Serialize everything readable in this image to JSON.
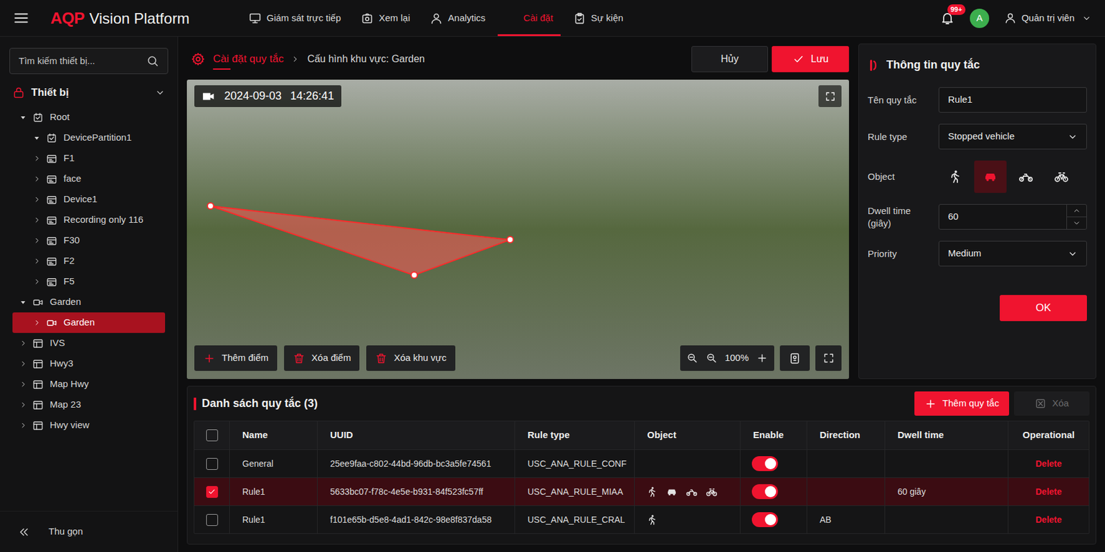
{
  "app": {
    "logo_mark": "AQP",
    "logo_text": "Vision Platform"
  },
  "nav": [
    {
      "label": "Giám sát trực tiếp",
      "kind": "monitor",
      "selected": false
    },
    {
      "label": "Xem lại",
      "kind": "playback",
      "selected": false
    },
    {
      "label": "Analytics",
      "kind": "analytics",
      "selected": false
    },
    {
      "label": "Cài đặt",
      "kind": "settings",
      "selected": true
    },
    {
      "label": "Sự kiện",
      "kind": "events",
      "selected": false
    }
  ],
  "header": {
    "notifications": "99+",
    "avatar": "A",
    "user": "Quản trị viên"
  },
  "sidebar": {
    "search": {
      "placeholder": "Tìm kiếm thiết bị..."
    },
    "section": {
      "label": "Thiết bị",
      "expanded": true
    },
    "tree": [
      {
        "label": "Root",
        "level": 0,
        "kind": "partition",
        "expanded": true,
        "selected": false
      },
      {
        "label": "DevicePartition1",
        "level": 1,
        "kind": "partition",
        "expanded": true,
        "selected": false
      },
      {
        "label": "F1",
        "level": 1,
        "kind": "device",
        "expanded": false,
        "selected": false
      },
      {
        "label": "face",
        "level": 1,
        "kind": "device",
        "expanded": false,
        "selected": false
      },
      {
        "label": "Device1",
        "level": 1,
        "kind": "device",
        "expanded": false,
        "selected": false
      },
      {
        "label": "Recording only 116",
        "level": 1,
        "kind": "device",
        "expanded": false,
        "selected": false
      },
      {
        "label": "F30",
        "level": 1,
        "kind": "device",
        "expanded": false,
        "selected": false
      },
      {
        "label": "F2",
        "level": 1,
        "kind": "device",
        "expanded": false,
        "selected": false
      },
      {
        "label": "F5",
        "level": 1,
        "kind": "device",
        "expanded": false,
        "selected": false
      },
      {
        "label": "Garden",
        "level": 0,
        "kind": "camera",
        "expanded": true,
        "selected": false
      },
      {
        "label": "Garden",
        "level": 1,
        "kind": "camera",
        "expanded": false,
        "selected": true
      },
      {
        "label": "IVS",
        "level": 0,
        "kind": "view",
        "expanded": false,
        "selected": false
      },
      {
        "label": "Hwy3",
        "level": 0,
        "kind": "view",
        "expanded": false,
        "selected": false
      },
      {
        "label": "Map Hwy",
        "level": 0,
        "kind": "view",
        "expanded": false,
        "selected": false
      },
      {
        "label": "Map 23",
        "level": 0,
        "kind": "view",
        "expanded": false,
        "selected": false
      },
      {
        "label": "Hwy view",
        "level": 0,
        "kind": "view",
        "expanded": false,
        "selected": false
      }
    ],
    "collapse": "Thu gọn"
  },
  "breadcrumb": [
    {
      "label": "Cài đặt quy tắc",
      "selected": true
    },
    {
      "label": "Cấu hình khu vực: Garden",
      "selected": false
    }
  ],
  "actions": {
    "cancel": "Hủy",
    "save": "Lưu"
  },
  "video": {
    "date": "2024-09-03",
    "time": "14:26:41",
    "region": {
      "points": [
        [
          0.036,
          0.422
        ],
        [
          0.488,
          0.535
        ],
        [
          0.343,
          0.653
        ]
      ]
    },
    "tools": [
      {
        "label": "Thêm điểm",
        "kind": "add"
      },
      {
        "label": "Xóa điểm",
        "kind": "delete"
      },
      {
        "label": "Xóa khu vực",
        "kind": "delete"
      }
    ],
    "zoom": "100%"
  },
  "rule_form": {
    "title": "Thông tin quy tắc",
    "name": {
      "label": "Tên quy tắc",
      "value": "Rule1"
    },
    "rule_type": {
      "label": "Rule type",
      "value": "Stopped vehicle"
    },
    "object": {
      "label": "Object",
      "options": [
        {
          "kind": "person",
          "selected": false
        },
        {
          "kind": "car",
          "selected": true
        },
        {
          "kind": "motorbike",
          "selected": false
        },
        {
          "kind": "bicycle",
          "selected": false
        }
      ]
    },
    "dwell_time": {
      "label": "Dwell time (giây)",
      "value": "60"
    },
    "priority": {
      "label": "Priority",
      "value": "Medium"
    },
    "ok": "OK"
  },
  "rule_list": {
    "title": "Danh sách quy tắc (3)",
    "add": "Thêm quy tắc",
    "remove": {
      "label": "Xóa",
      "disabled": true
    },
    "all_checked": false,
    "columns": [
      "Name",
      "UUID",
      "Rule type",
      "Object",
      "Enable",
      "Direction",
      "Dwell time",
      "Operational"
    ],
    "rows": [
      {
        "checked": false,
        "name": "General",
        "uuid": "25ee9faa-c802-44bd-96db-bc3a5fe74561",
        "rule_type": "USC_ANA_RULE_CONF",
        "objects": [],
        "enabled": true,
        "action": "Delete"
      },
      {
        "checked": true,
        "name": "Rule1",
        "uuid": "5633bc07-f78c-4e5e-b931-84f523fc57ff",
        "rule_type": "USC_ANA_RULE_MIAA",
        "objects": [
          {
            "kind": "person"
          },
          {
            "kind": "car"
          },
          {
            "kind": "motorbike"
          },
          {
            "kind": "bicycle"
          }
        ],
        "enabled": true,
        "dwell_time": "60 giây",
        "action": "Delete"
      },
      {
        "checked": false,
        "name": "Rule1",
        "uuid": "f101e65b-d5e8-4ad1-842c-98e8f837da58",
        "rule_type": "USC_ANA_RULE_CRAL",
        "objects": [
          {
            "kind": "person"
          }
        ],
        "enabled": true,
        "direction": "AB",
        "action": "Delete"
      }
    ]
  }
}
